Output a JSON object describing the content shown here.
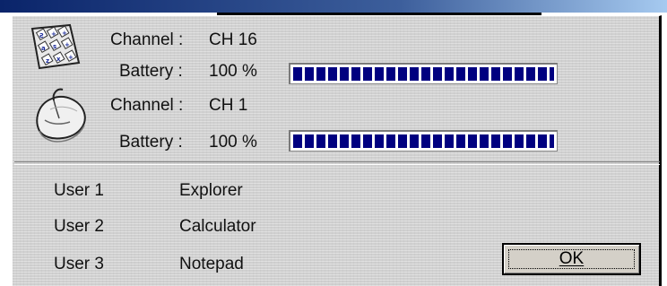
{
  "keyboard": {
    "icon": "keyboard-icon",
    "channel_label": "Channel :",
    "channel_value": "CH 16",
    "battery_label": "Battery :",
    "battery_value": "100 %",
    "battery_level": 1.0
  },
  "mouse": {
    "icon": "mouse-icon",
    "channel_label": "Channel :",
    "channel_value": "CH 1",
    "battery_label": "Battery :",
    "battery_value": "100 %",
    "battery_level": 1.0
  },
  "users": [
    {
      "name": "User 1",
      "app": "Explorer"
    },
    {
      "name": "User 2",
      "app": "Calculator"
    },
    {
      "name": "User 3",
      "app": "Notepad"
    }
  ],
  "ok_button": {
    "label": "OK"
  },
  "colors": {
    "progress": "#000080",
    "titlebar": "#0a246a",
    "dialog_bg": "#d9d9d9"
  }
}
